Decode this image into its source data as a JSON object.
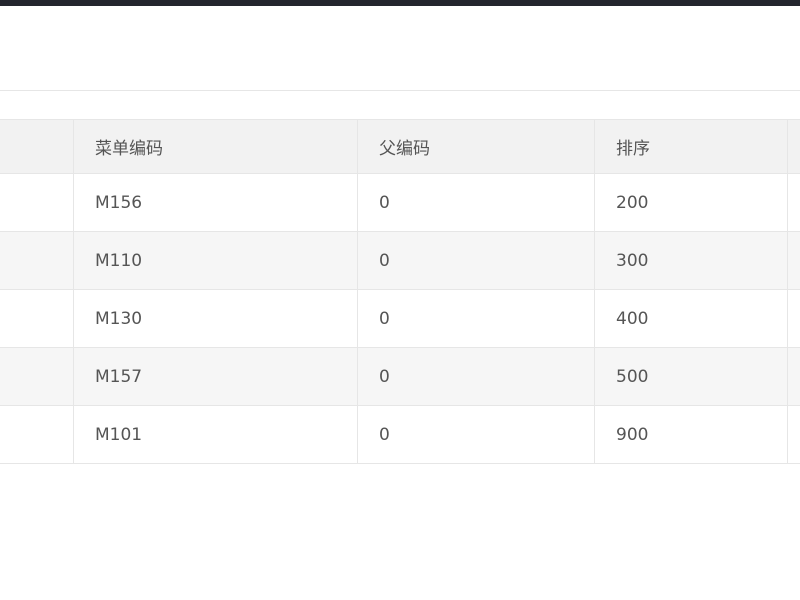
{
  "table": {
    "headers": [
      "",
      "菜单编码",
      "父编码",
      "排序",
      ""
    ],
    "rows": [
      [
        "",
        "M156",
        "0",
        "200",
        ""
      ],
      [
        "",
        "M110",
        "0",
        "300",
        ""
      ],
      [
        "",
        "M130",
        "0",
        "400",
        ""
      ],
      [
        "",
        "M157",
        "0",
        "500",
        ""
      ],
      [
        "",
        "M101",
        "0",
        "900",
        ""
      ]
    ]
  }
}
